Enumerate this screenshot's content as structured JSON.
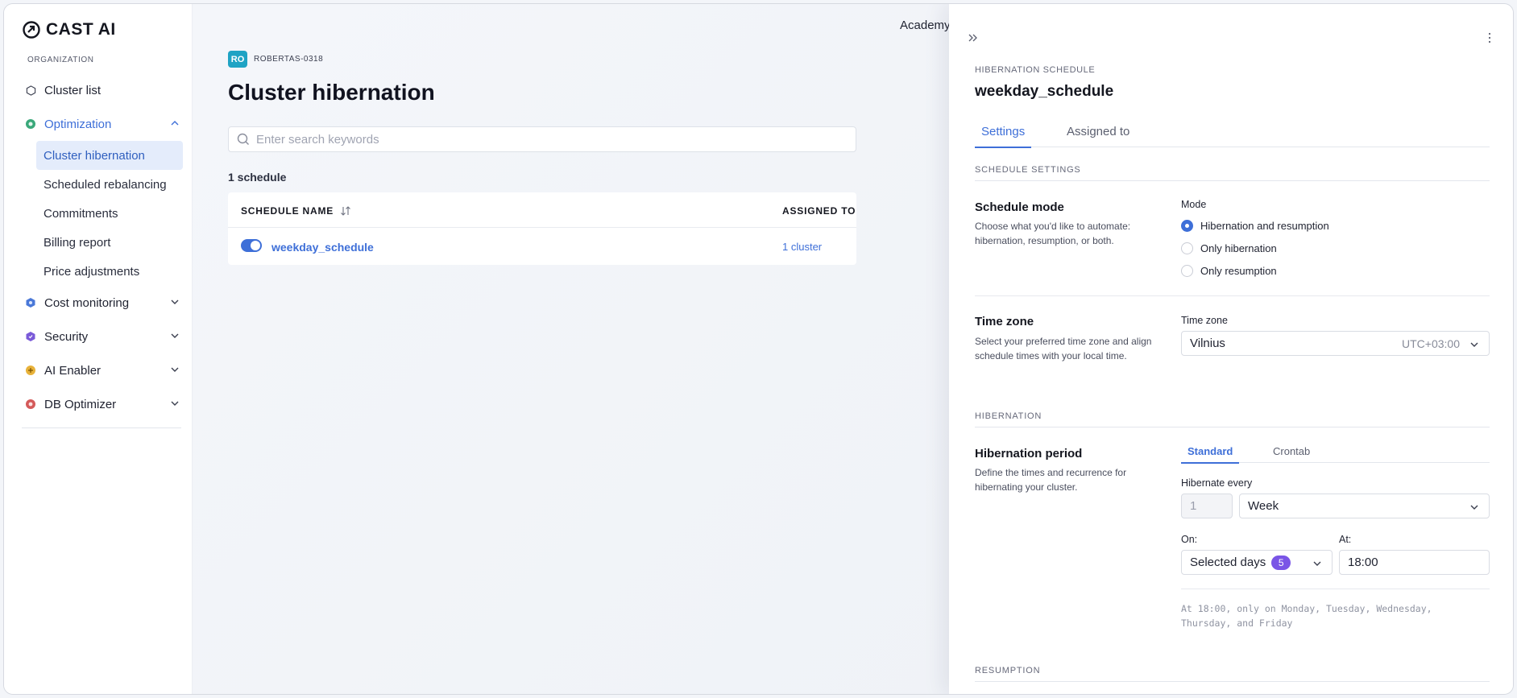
{
  "brand": {
    "name": "CAST AI",
    "accent": "#3e6fd8"
  },
  "sidebar": {
    "org_label": "ORGANIZATION",
    "items": [
      {
        "label": "Cluster list",
        "icon": "hexagon-icon"
      },
      {
        "label": "Optimization",
        "icon": "optimization-icon",
        "expanded": true
      },
      {
        "label": "Cost monitoring",
        "icon": "cost-monitoring-icon"
      },
      {
        "label": "Security",
        "icon": "security-icon"
      },
      {
        "label": "AI Enabler",
        "icon": "ai-enabler-icon"
      },
      {
        "label": "DB Optimizer",
        "icon": "db-optimizer-icon"
      }
    ],
    "optimization_sub": [
      {
        "label": "Cluster hibernation",
        "selected": true
      },
      {
        "label": "Scheduled rebalancing"
      },
      {
        "label": "Commitments"
      },
      {
        "label": "Billing report"
      },
      {
        "label": "Price adjustments"
      }
    ]
  },
  "topbar": {
    "academy": "Academy"
  },
  "main": {
    "org_initials": "RO",
    "org_name": "ROBERTAS-0318",
    "title": "Cluster hibernation",
    "search_placeholder": "Enter search keywords",
    "count": "1 schedule",
    "table": {
      "headers": [
        "SCHEDULE NAME",
        "ASSIGNED TO"
      ],
      "rows": [
        {
          "enabled": true,
          "name": "weekday_schedule",
          "assigned": "1 cluster"
        }
      ]
    }
  },
  "drawer": {
    "kicker": "HIBERNATION SCHEDULE",
    "title": "weekday_schedule",
    "tabs": [
      "Settings",
      "Assigned to"
    ],
    "active_tab": "Settings",
    "schedule_settings_head": "SCHEDULE SETTINGS",
    "mode": {
      "title": "Schedule mode",
      "desc": "Choose what you'd like to automate: hibernation, resumption, or both.",
      "label": "Mode",
      "options": [
        "Hibernation and resumption",
        "Only hibernation",
        "Only resumption"
      ],
      "selected": "Hibernation and resumption"
    },
    "timezone": {
      "title": "Time zone",
      "desc": "Select your preferred time zone and align schedule times with your local time.",
      "label": "Time zone",
      "value": "Vilnius",
      "offset": "UTC+03:00"
    },
    "hibernation_head": "HIBERNATION",
    "period": {
      "title": "Hibernation period",
      "desc": "Define the times and recurrence for hibernating your cluster.",
      "subtabs": [
        "Standard",
        "Crontab"
      ],
      "active_subtab": "Standard",
      "every_label": "Hibernate every",
      "every_value": "1",
      "unit": "Week",
      "on_label": "On:",
      "on_value": "Selected days",
      "on_count": "5",
      "at_label": "At:",
      "at_value": "18:00",
      "help": "At 18:00, only on Monday, Tuesday, Wednesday, Thursday, and Friday"
    },
    "resumption_head": "RESUMPTION"
  }
}
